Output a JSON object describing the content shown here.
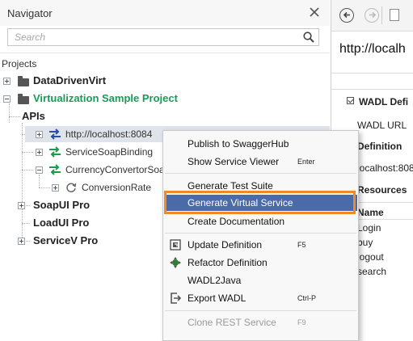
{
  "navigator": {
    "title": "Navigator",
    "search_placeholder": "Search",
    "projects_label": "Projects"
  },
  "tree": {
    "data_driven_virt": "DataDrivenVirt",
    "virtualization_project": "Virtualization Sample Project",
    "apis": "APIs",
    "localhost": "http://localhost:8084",
    "service_soap_binding": "ServiceSoapBinding",
    "currency_convertor": "CurrencyConvertorSoa",
    "conversion_rate": "ConversionRate",
    "soapui_pro": "SoapUI Pro",
    "loadui_pro": "LoadUI Pro",
    "servicev_pro": "ServiceV Pro"
  },
  "colors": {
    "project_green": "#1a9a5a",
    "menu_highlight": "#4a6ba8",
    "callout_orange": "#f08a24",
    "selection": "#dfe4ea"
  },
  "context_menu": {
    "items": [
      {
        "label": "Publish to SwaggerHub",
        "shortcut": ""
      },
      {
        "label": "Show Service Viewer",
        "shortcut": "Enter"
      },
      {
        "label": "Generate Test Suite",
        "shortcut": ""
      },
      {
        "label": "Generate Virtual Service",
        "shortcut": "",
        "highlighted": true
      },
      {
        "label": "Create Documentation",
        "shortcut": ""
      },
      {
        "label": "Update Definition",
        "shortcut": "F5",
        "icon": "update-definition-icon"
      },
      {
        "label": "Refactor Definition",
        "shortcut": "",
        "icon": "refactor-icon"
      },
      {
        "label": "WADL2Java",
        "shortcut": ""
      },
      {
        "label": "Export WADL",
        "shortcut": "Ctrl-P",
        "icon": "export-icon"
      },
      {
        "label": "Clone REST Service",
        "shortcut": "F9",
        "disabled": true
      }
    ]
  },
  "right_panel": {
    "url": "http://localh",
    "wadl_header": "WADL Defi",
    "wadl_url": "WADL URL",
    "definition": "Definition",
    "localhost": "localhost:808",
    "resources": "Resources",
    "name_header": "Name",
    "rows": [
      "Login",
      "buy",
      "logout",
      "search"
    ]
  }
}
